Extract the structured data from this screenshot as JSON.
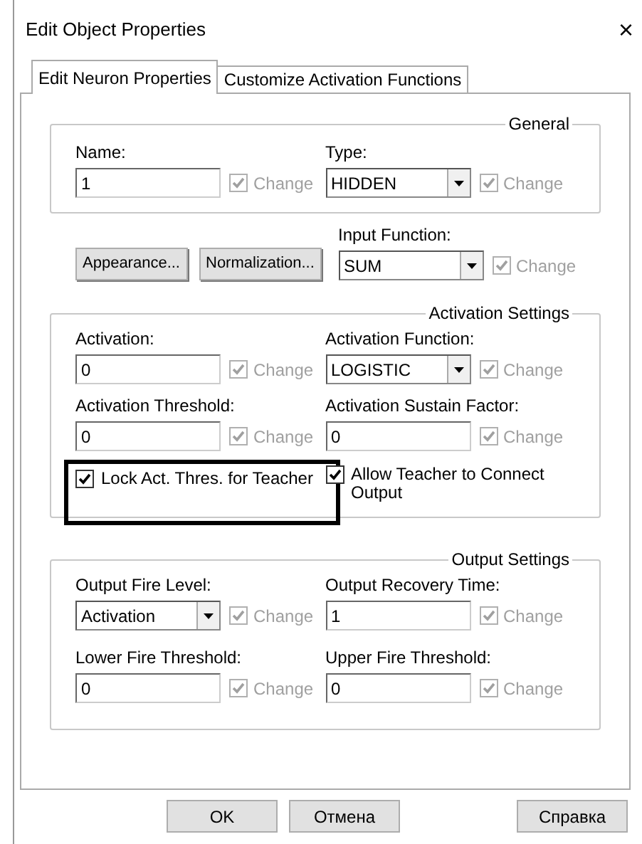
{
  "window": {
    "title": "Edit Object Properties",
    "close": "×"
  },
  "tabs": [
    {
      "label": "Edit Neuron Properties",
      "selected": true
    },
    {
      "label": "Customize Activation Functions",
      "selected": false
    }
  ],
  "general": {
    "title": "General",
    "fields": [
      {
        "label": "Name:",
        "kind": "text",
        "value": "1",
        "change": {
          "label": "Change",
          "checked": true,
          "disabled": true
        }
      },
      {
        "label": "Type:",
        "kind": "select",
        "value": "HIDDEN",
        "change": {
          "label": "Change",
          "checked": true,
          "disabled": true
        }
      }
    ]
  },
  "middle": {
    "buttons": [
      "Appearance...",
      "Normalization..."
    ],
    "field": {
      "label": "Input Function:",
      "kind": "select",
      "value": "SUM",
      "change": {
        "label": "Change",
        "checked": true,
        "disabled": true
      }
    }
  },
  "activation": {
    "title": "Activation Settings",
    "fields": [
      {
        "label": "Activation:",
        "kind": "text",
        "value": "0",
        "change": {
          "label": "Change",
          "checked": true,
          "disabled": true
        }
      },
      {
        "label": "Activation Function:",
        "kind": "select",
        "value": "LOGISTIC",
        "change": {
          "label": "Change",
          "checked": true,
          "disabled": true
        }
      },
      {
        "label": "Activation Threshold:",
        "kind": "text",
        "value": "0",
        "change": {
          "label": "Change",
          "checked": true,
          "disabled": true
        }
      },
      {
        "label": "Activation Sustain Factor:",
        "kind": "text",
        "value": "0",
        "change": {
          "label": "Change",
          "checked": true,
          "disabled": true
        }
      }
    ],
    "checkboxes": [
      {
        "label": "Lock Act. Thres. for Teacher",
        "checked": true,
        "highlighted": true
      },
      {
        "label": "Allow Teacher to Connect Output",
        "checked": true,
        "highlighted": false
      }
    ]
  },
  "output": {
    "title": "Output Settings",
    "fields": [
      {
        "label": "Output Fire Level:",
        "kind": "select",
        "value": "Activation",
        "change": {
          "label": "Change",
          "checked": true,
          "disabled": true
        }
      },
      {
        "label": "Output Recovery Time:",
        "kind": "text",
        "value": "1",
        "change": {
          "label": "Change",
          "checked": true,
          "disabled": true
        }
      },
      {
        "label": "Lower Fire Threshold:",
        "kind": "text",
        "value": "0",
        "change": {
          "label": "Change",
          "checked": true,
          "disabled": true
        }
      },
      {
        "label": "Upper Fire Threshold:",
        "kind": "text",
        "value": "0",
        "change": {
          "label": "Change",
          "checked": true,
          "disabled": true
        }
      }
    ]
  },
  "footer_buttons": [
    "OK",
    "Отмена",
    "Справка"
  ]
}
